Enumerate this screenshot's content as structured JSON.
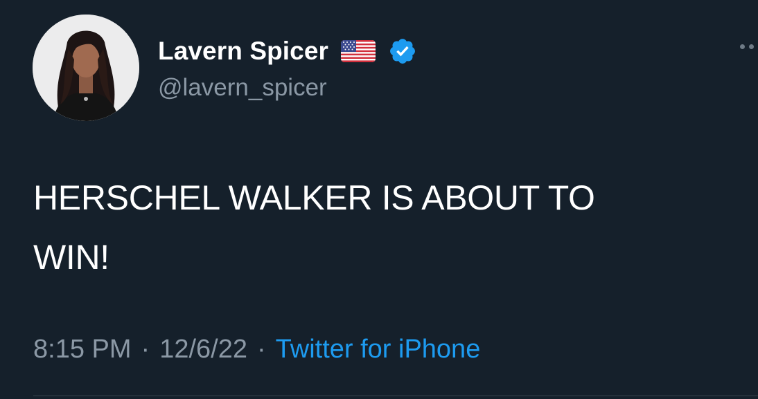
{
  "author": {
    "display_name": "Lavern Spicer",
    "handle": "@lavern_spicer",
    "flag_icon": "us-flag-icon",
    "verified_icon": "verified-badge-icon",
    "verified_color": "#1d9bf0"
  },
  "tweet": {
    "text": "HERSCHEL WALKER IS ABOUT TO\nWIN!",
    "time": "8:15 PM",
    "date": "12/6/22",
    "separator": "·",
    "source": "Twitter for iPhone"
  },
  "colors": {
    "background": "#15202b",
    "secondary_text": "#8b98a5",
    "link": "#1d9bf0"
  }
}
